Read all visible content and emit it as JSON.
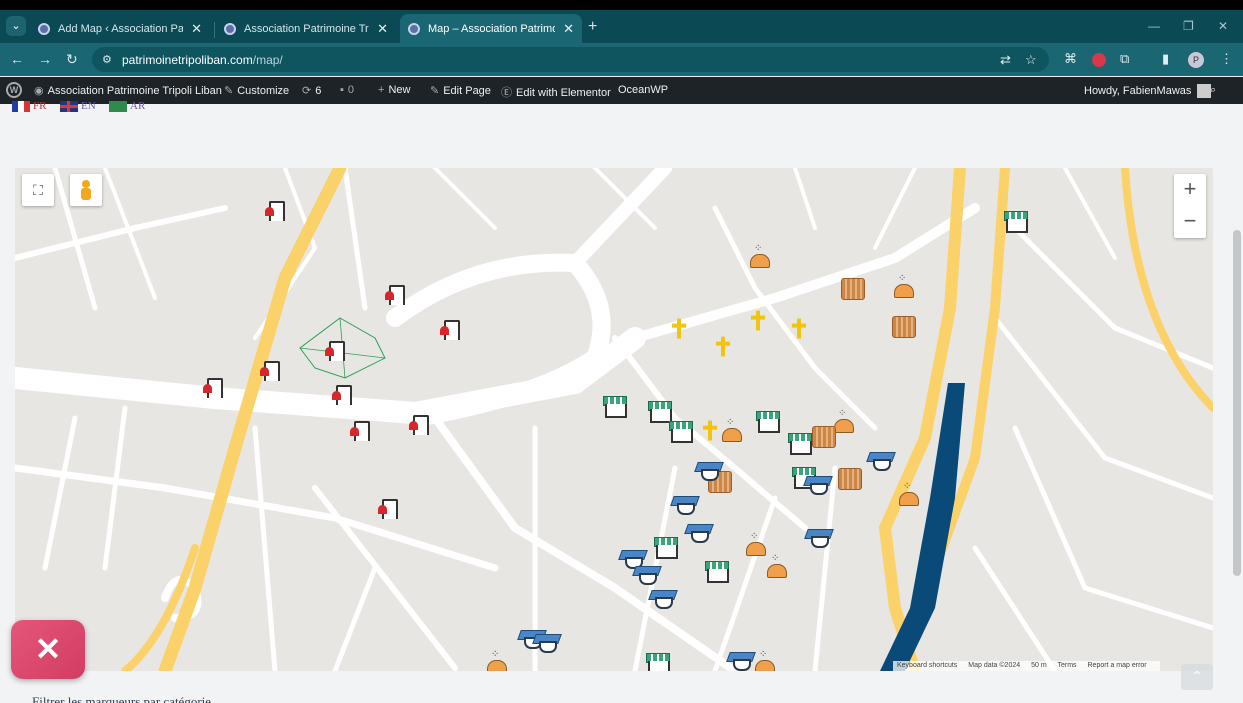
{
  "browser": {
    "tabs": [
      {
        "title": "Add Map ‹ Association Patrimo",
        "active": false
      },
      {
        "title": "Association Patrimoine Tripoli L",
        "active": false
      },
      {
        "title": "Map – Association Patrimoine T",
        "active": true
      }
    ],
    "url_host": "patrimoinetripoliban.com",
    "url_path": "/map/"
  },
  "wp_admin_bar": {
    "site_name": "Association Patrimoine Tripoli Liban",
    "customize": "Customize",
    "updates_count": "6",
    "comments_count": "0",
    "new": "New",
    "edit_page": "Edit Page",
    "edit_elementor": "Edit with Elementor",
    "theme": "OceanWP",
    "howdy": "Howdy, FabienMawas"
  },
  "languages": [
    {
      "code": "FR"
    },
    {
      "code": "EN"
    },
    {
      "code": "AR"
    }
  ],
  "map": {
    "zoom_in": "+",
    "zoom_out": "−",
    "attribution": {
      "keyboard": "Keyboard shortcuts",
      "data": "Map data ©2024",
      "scale": "50 m",
      "terms": "Terms",
      "report": "Report a map error"
    },
    "markers": {
      "buildings": 12,
      "domes": 9,
      "crosses": 5,
      "colosseums": 5,
      "shops": 10,
      "graduation_caps": 14
    }
  },
  "below_text": "Filtrer les marqueurs par catégorie"
}
